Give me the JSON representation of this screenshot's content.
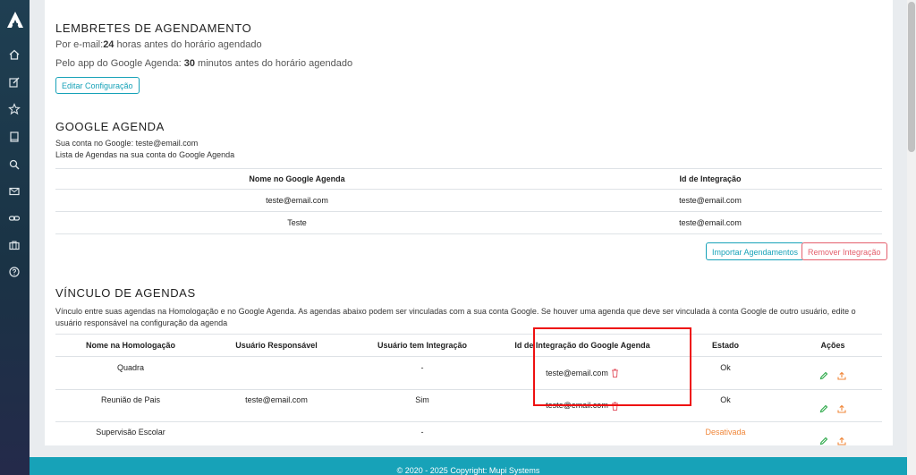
{
  "sidebar": {
    "icons": [
      "home-icon",
      "edit-icon",
      "star-icon",
      "book-icon",
      "search-icon",
      "mail-icon",
      "link-icon",
      "briefcase-icon",
      "help-icon"
    ]
  },
  "reminders": {
    "title": "LEMBRETES DE AGENDAMENTO",
    "email_prefix": "Por e-mail:",
    "email_value": "24",
    "email_suffix": " horas antes do horário agendado",
    "app_prefix": "Pelo app do Google Agenda: ",
    "app_value": "30",
    "app_suffix": " minutos antes do horário agendado",
    "edit_button": "Editar Configuração"
  },
  "google": {
    "title": "GOOGLE AGENDA",
    "account_line": "Sua conta no Google: teste@email.com",
    "list_line": "Lista de Agendas na sua conta do Google Agenda",
    "columns": [
      "Nome no Google Agenda",
      "Id de Integração"
    ],
    "rows": [
      {
        "name": "teste@email.com",
        "id": "teste@email.com"
      },
      {
        "name": "Teste",
        "id": "teste@email.com"
      }
    ],
    "import_button": "Importar Agendamentos",
    "remove_button": "Remover Integração"
  },
  "link": {
    "title": "VÍNCULO DE AGENDAS",
    "description": "Vínculo entre suas agendas na Homologação e no Google Agenda. As agendas abaixo podem ser vinculadas com a sua conta Google. Se houver uma agenda que deve ser vinculada à conta Google de outro usuário, edite o usuário responsável na configuração da agenda",
    "columns": [
      "Nome na Homologação",
      "Usuário Responsável",
      "Usuário tem Integração",
      "Id de Integração do Google Agenda",
      "Estado",
      "Ações"
    ],
    "rows": [
      {
        "name": "Quadra",
        "user": "",
        "has_integration": "-",
        "google_id": "teste@email.com",
        "state": "Ok"
      },
      {
        "name": "Reunião de Pais",
        "user": "teste@email.com",
        "has_integration": "Sim",
        "google_id": "teste@email.com",
        "state": "Ok"
      },
      {
        "name": "Supervisão Escolar",
        "user": "",
        "has_integration": "-",
        "google_id": "",
        "state": "Desativada"
      }
    ]
  },
  "footer": {
    "text": "© 2020 - 2025 Copyright: ",
    "link": "Mupi Systems"
  },
  "colors": {
    "accent": "#17a2b8",
    "danger": "#e4606d",
    "edit": "#28a745",
    "upload": "#f0873a",
    "highlight": "#ee1111"
  }
}
